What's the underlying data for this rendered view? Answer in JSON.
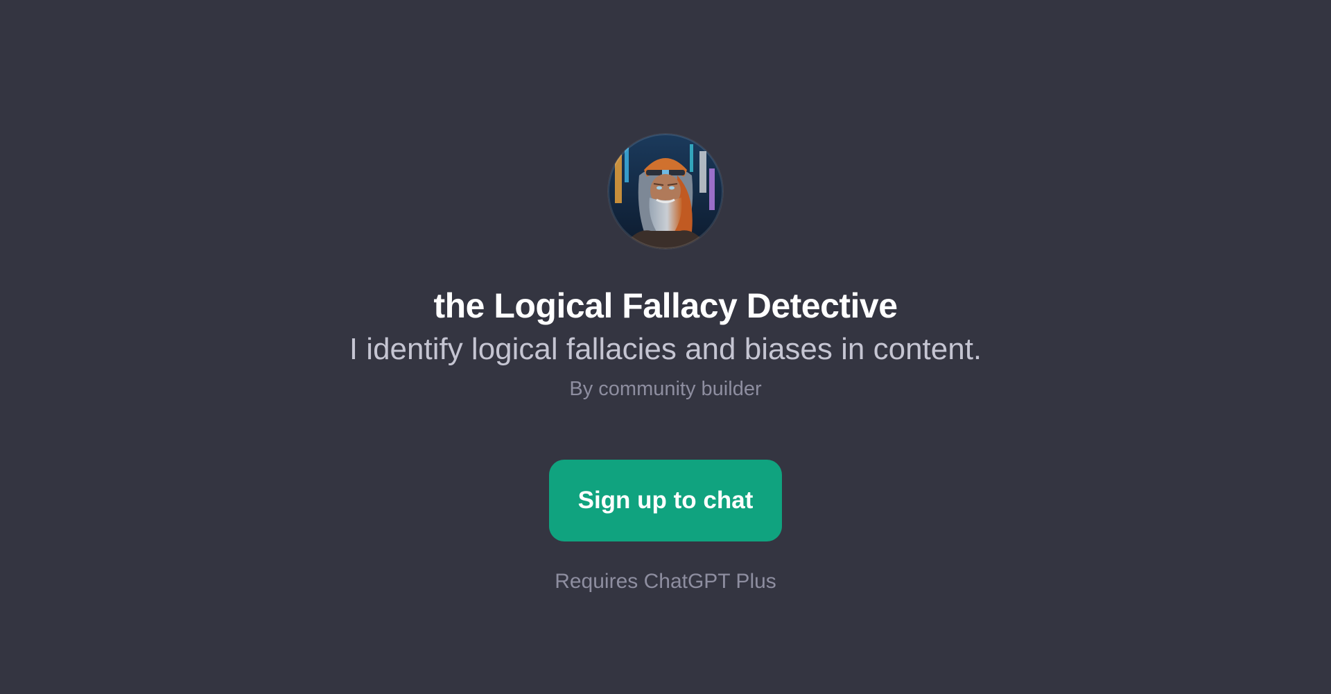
{
  "gpt": {
    "avatar_icon": "bearded-detective-portrait-icon",
    "name": "the Logical Fallacy Detective",
    "description": "I identify logical fallacies and biases in content.",
    "author": "By community builder"
  },
  "actions": {
    "signup_label": "Sign up to chat",
    "requirement_note": "Requires ChatGPT Plus"
  },
  "colors": {
    "background": "#343541",
    "accent": "#10a37f",
    "title": "#ffffff",
    "subtitle": "#c5c5d2",
    "muted": "#8e8ea0"
  }
}
